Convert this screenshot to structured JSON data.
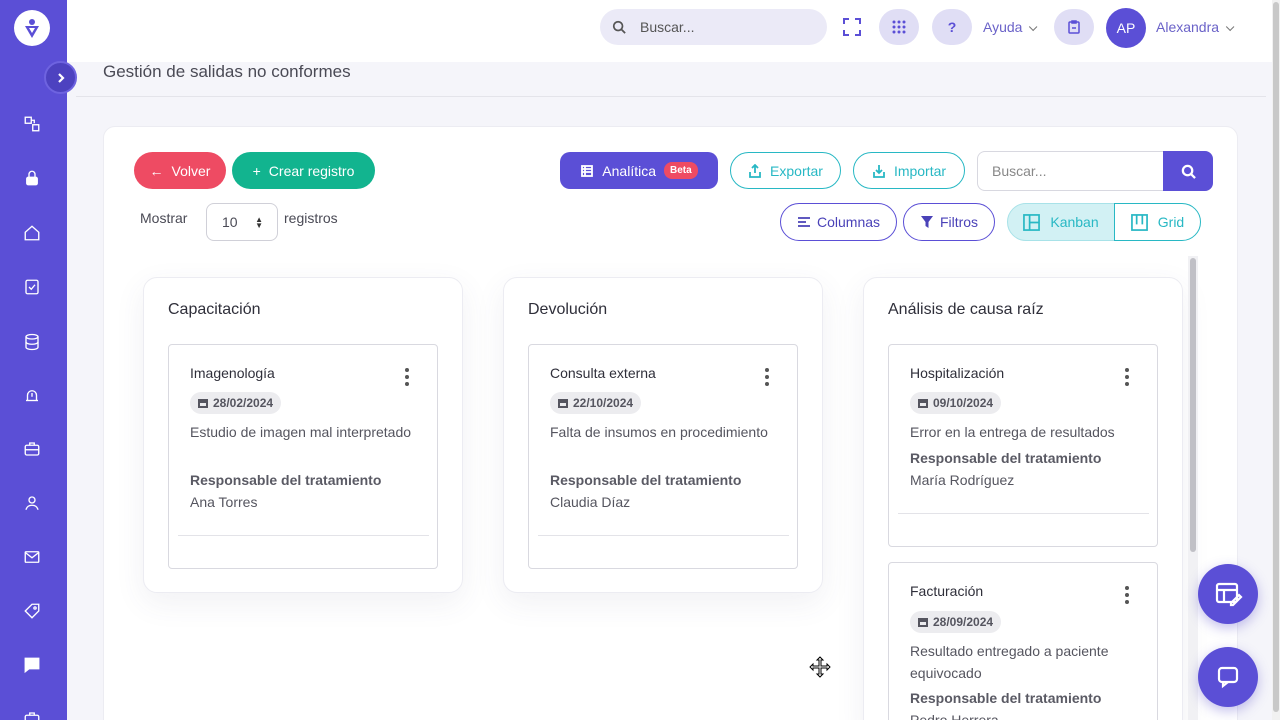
{
  "topbar": {
    "search_placeholder": "Buscar...",
    "help_label": "Ayuda",
    "help_symbol": "?",
    "user_initials": "AP",
    "user_name": "Alexandra"
  },
  "page": {
    "title": "Gestión de salidas no conformes"
  },
  "toolbar": {
    "back_label": "Volver",
    "create_label": "Crear registro",
    "analytics_label": "Analítica",
    "beta_badge": "Beta",
    "export_label": "Exportar",
    "import_label": "Importar",
    "search_placeholder": "Buscar...",
    "show_label": "Mostrar",
    "page_size": "10",
    "records_label": "registros",
    "columns_label": "Columnas",
    "filters_label": "Filtros",
    "kanban_label": "Kanban",
    "grid_label": "Grid"
  },
  "colors": {
    "primary": "#5b4fd6",
    "danger": "#ee4b63",
    "success": "#12b48f",
    "info": "#28b8c4"
  },
  "board": {
    "columns": [
      {
        "title": "Capacitación",
        "cards": [
          {
            "title": "Imagenología",
            "date": "28/02/2024",
            "description": "Estudio de imagen mal interpretado",
            "responsible_label": "Responsable del tratamiento",
            "responsible": "Ana Torres"
          }
        ]
      },
      {
        "title": "Devolución",
        "cards": [
          {
            "title": "Consulta externa",
            "date": "22/10/2024",
            "description": "Falta de insumos en procedimiento",
            "responsible_label": "Responsable del tratamiento",
            "responsible": "Claudia Díaz"
          }
        ]
      },
      {
        "title": "Análisis de causa raíz",
        "cards": [
          {
            "title": "Hospitalización",
            "date": "09/10/2024",
            "description": "Error en la entrega de resultados",
            "responsible_label": "Responsable del tratamiento",
            "responsible": "María Rodríguez"
          },
          {
            "title": "Facturación",
            "date": "28/09/2024",
            "description": "Resultado entregado a paciente equivocado",
            "responsible_label": "Responsable del tratamiento",
            "responsible": "Pedro Herrera"
          }
        ]
      }
    ]
  }
}
